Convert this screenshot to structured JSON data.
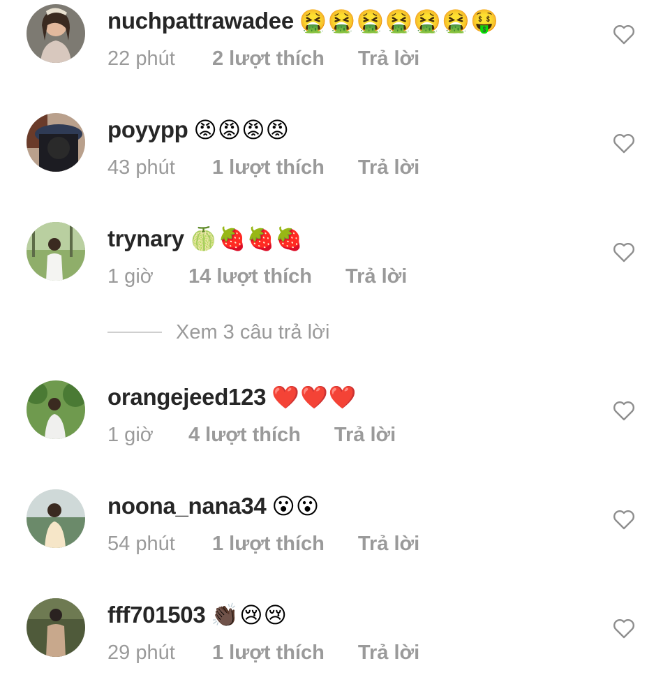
{
  "comments": [
    {
      "username": "nuchpattrawadee",
      "emojis": "🤮🤮🤮🤮🤮🤮🤑",
      "time": "22 phút",
      "likes": "2 lượt thích",
      "reply": "Trả lời"
    },
    {
      "username": "poyypp",
      "emojis": "😡😡😡😡",
      "time": "43 phút",
      "likes": "1 lượt thích",
      "reply": "Trả lời"
    },
    {
      "username": "trynary",
      "emojis": "🍈🍓🍓🍓",
      "time": "1 giờ",
      "likes": "14 lượt thích",
      "reply": "Trả lời"
    },
    {
      "username": "orangejeed123",
      "emojis": "❤️❤️❤️",
      "time": "1 giờ",
      "likes": "4 lượt thích",
      "reply": "Trả lời"
    },
    {
      "username": "noona_nana34",
      "emojis": "😮😮",
      "time": "54 phút",
      "likes": "1 lượt thích",
      "reply": "Trả lời"
    },
    {
      "username": "fff701503",
      "emojis": "👏🏿😢😢",
      "time": "29 phút",
      "likes": "1 lượt thích",
      "reply": "Trả lời"
    }
  ],
  "view_replies": "Xem 3 câu trả lời",
  "icons": {
    "like": "heart-outline-icon"
  },
  "colors": {
    "username": "#262626",
    "meta": "#9a9a9a",
    "heart": "#8e8e8e"
  }
}
